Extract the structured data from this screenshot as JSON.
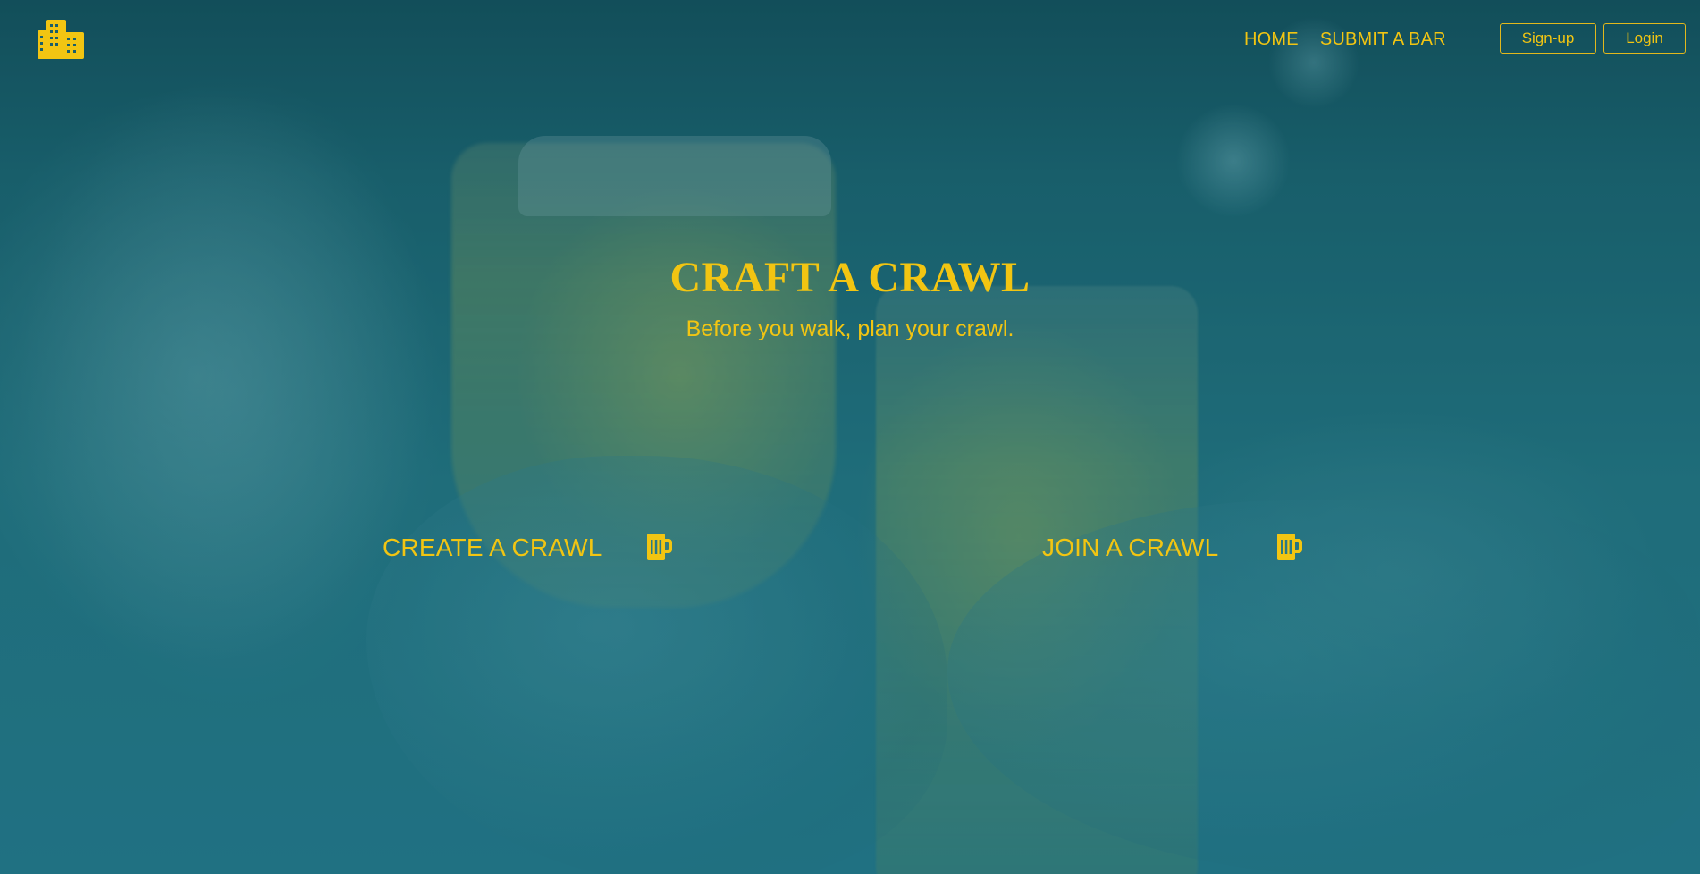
{
  "header": {
    "logo_icon": "city-buildings-icon",
    "nav": [
      {
        "label": "HOME"
      },
      {
        "label": "SUBMIT A BAR"
      }
    ],
    "auth": {
      "signup_label": "Sign-up",
      "login_label": "Login"
    }
  },
  "hero": {
    "title": "CRAFT A CRAWL",
    "subtitle": "Before you walk, plan your crawl."
  },
  "actions": {
    "create": {
      "label": "CREATE A CRAWL",
      "icon": "beer-mug-icon"
    },
    "join": {
      "label": "JOIN A CRAWL",
      "icon": "beer-mug-icon"
    }
  },
  "colors": {
    "accent": "#f2c512",
    "overlay": "#21707e"
  }
}
